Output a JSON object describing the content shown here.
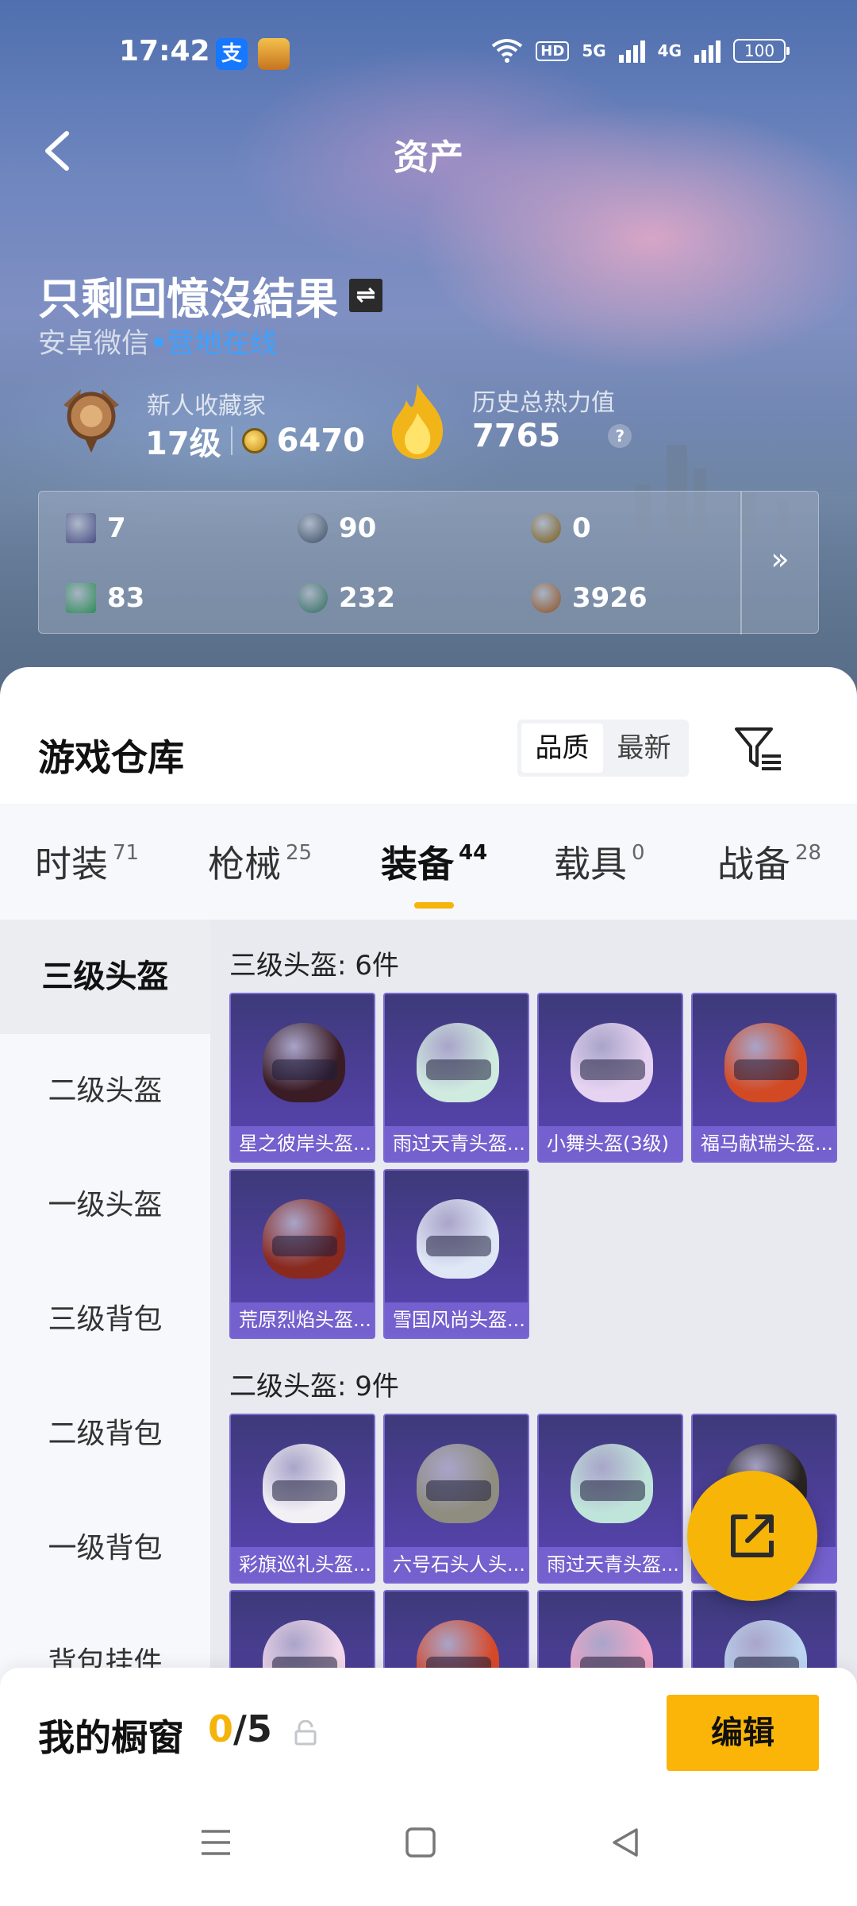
{
  "status_bar": {
    "time": "17:42",
    "alipay_glyph": "支",
    "hd": "HD",
    "net1": "5G",
    "net2": "4G",
    "battery": "100"
  },
  "header": {
    "title": "资产",
    "back_icon": "chevron-left-icon"
  },
  "profile": {
    "username": "只剩回憶沒結果",
    "swap_glyph": "⇌",
    "platform": "安卓微信",
    "online_status": "营地在线",
    "collector_title": "新人收藏家",
    "level": "17级",
    "coins": "6470",
    "heat_label": "历史总热力值",
    "heat_value": "7765",
    "help_glyph": "?"
  },
  "currencies": [
    {
      "value": "7",
      "color": "#4a4f86",
      "icon": "card-icon"
    },
    {
      "value": "90",
      "color": "#3b4c63",
      "icon": "silver-coin-icon"
    },
    {
      "value": "0",
      "color": "#7a5a15",
      "icon": "gold-coin-icon"
    },
    {
      "value": "83",
      "color": "#2f8d58",
      "icon": "green-card-icon"
    },
    {
      "value": "232",
      "color": "#2f6d5d",
      "icon": "orb-icon"
    },
    {
      "value": "3926",
      "color": "#8f4f1f",
      "icon": "bronze-coin-icon"
    }
  ],
  "currency_more": "»",
  "warehouse": {
    "title": "游戏仓库",
    "sort_options": [
      "品质",
      "最新"
    ],
    "sort_selected": "品质"
  },
  "tabs": [
    {
      "label": "时装",
      "count": "71"
    },
    {
      "label": "枪械",
      "count": "25"
    },
    {
      "label": "装备",
      "count": "44",
      "active": true
    },
    {
      "label": "载具",
      "count": "0"
    },
    {
      "label": "战备",
      "count": "28"
    }
  ],
  "sidebar": {
    "items": [
      "三级头盔",
      "二级头盔",
      "一级头盔",
      "三级背包",
      "二级背包",
      "一级背包",
      "背包挂件"
    ],
    "active_index": 0
  },
  "sections": [
    {
      "heading": "三级头盔: 6件",
      "items": [
        {
          "name": "星之彼岸头盔...",
          "color": "#3a1c24"
        },
        {
          "name": "雨过天青头盔...",
          "color": "#cfeadf"
        },
        {
          "name": "小舞头盔(3级)",
          "color": "#e6d3f1"
        },
        {
          "name": "福马献瑞头盔...",
          "color": "#d24a23"
        },
        {
          "name": "荒原烈焰头盔...",
          "color": "#8a2a1e"
        },
        {
          "name": "雪国风尚头盔...",
          "color": "#dfe7f6"
        }
      ]
    },
    {
      "heading": "二级头盔: 9件",
      "items": [
        {
          "name": "彩旗巡礼头盔...",
          "color": "#f2f0f5"
        },
        {
          "name": "六号石头人头...",
          "color": "#8f8d80"
        },
        {
          "name": "雨过天青头盔...",
          "color": "#bfe4da"
        },
        {
          "name": "...",
          "color": "#2a2420"
        },
        {
          "name": "",
          "color": "#f3d8ea"
        },
        {
          "name": "",
          "color": "#d64a2a"
        },
        {
          "name": "",
          "color": "#f2a8c8"
        },
        {
          "name": "",
          "color": "#bcd6f2"
        }
      ]
    }
  ],
  "showcase": {
    "label": "我的橱窗",
    "current": "0",
    "total": "/5",
    "edit": "编辑"
  }
}
